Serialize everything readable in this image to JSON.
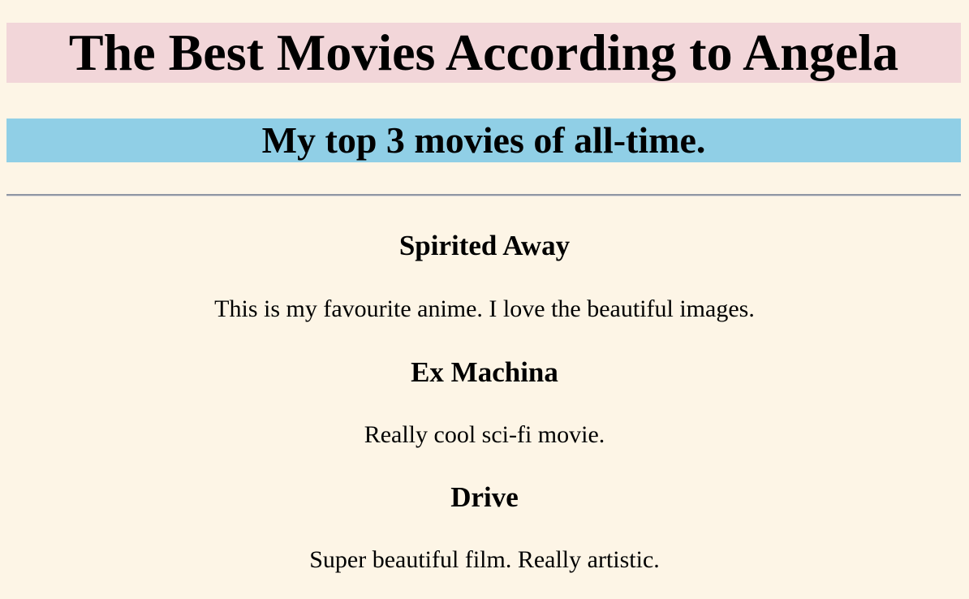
{
  "header": {
    "title": "The Best Movies According to Angela",
    "subtitle": "My top 3 movies of all-time."
  },
  "movies": [
    {
      "name": "Spirited Away",
      "description": "This is my favourite anime. I love the beautiful images."
    },
    {
      "name": "Ex Machina",
      "description": "Really cool sci-fi movie."
    },
    {
      "name": "Drive",
      "description": "Super beautiful film. Really artistic."
    }
  ],
  "colors": {
    "page_background": "#fdf5e6",
    "title_background": "#f2d6d9",
    "subtitle_background": "#90cfe6",
    "divider": "#8f96a3"
  }
}
